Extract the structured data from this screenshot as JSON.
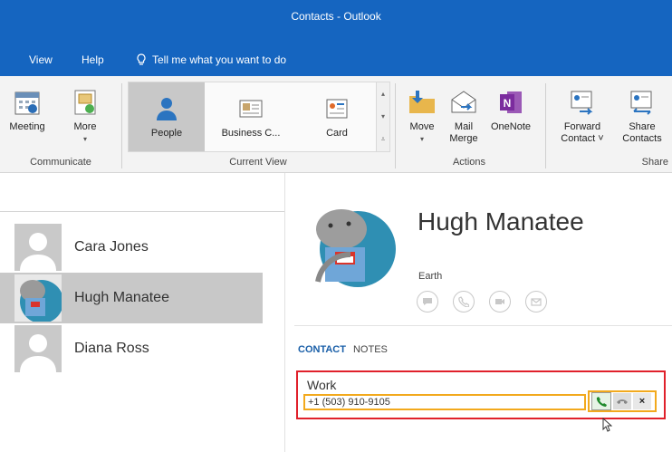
{
  "window": {
    "title": "Contacts - Outlook"
  },
  "menu": {
    "view": "View",
    "help": "Help",
    "tell_me": "Tell me what you want to do"
  },
  "ribbon": {
    "communicate": {
      "label": "Communicate",
      "meeting": "Meeting",
      "more": "More"
    },
    "current_view": {
      "label": "Current View",
      "people": "People",
      "business_card": "Business C...",
      "card": "Card"
    },
    "actions": {
      "label": "Actions",
      "move": "Move",
      "mail_merge_1": "Mail",
      "mail_merge_2": "Merge",
      "onenote": "OneNote"
    },
    "share": {
      "label": "Share",
      "forward_1": "Forward",
      "forward_2": "Contact ˅",
      "share_1": "Share",
      "share_2": "Contacts"
    }
  },
  "contacts": [
    {
      "name": "Cara Jones"
    },
    {
      "name": "Hugh Manatee"
    },
    {
      "name": "Diana Ross"
    }
  ],
  "detail": {
    "name": "Hugh Manatee",
    "location": "Earth",
    "tab_contact": "CONTACT",
    "tab_notes": "NOTES",
    "work_label": "Work",
    "phone": "+1 (503) 910-9105",
    "close_glyph": "×"
  },
  "colors": {
    "titlebar": "#1565c0",
    "highlight_red": "#e0212b",
    "highlight_orange": "#f2a91d",
    "tab_active": "#1a5fa8"
  }
}
